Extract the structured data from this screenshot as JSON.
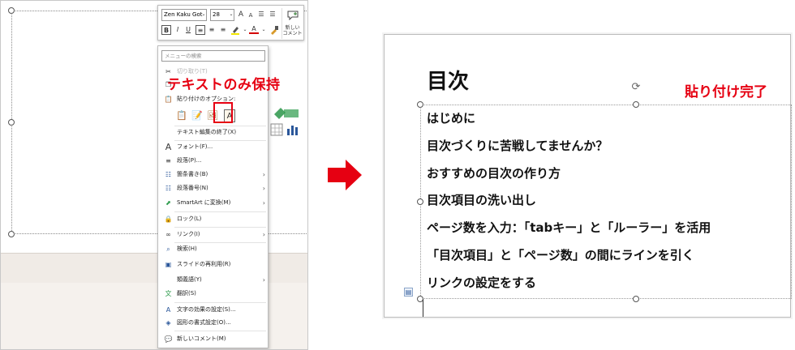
{
  "left_panel": {
    "mini_toolbar": {
      "font_name": "Zen Kaku Got",
      "font_size": "28",
      "grow_font": "A",
      "shrink_font": "A",
      "bold": "B",
      "italic": "I",
      "underline": "U",
      "font_color_letter": "A",
      "new_comment_label_1": "新しい",
      "new_comment_label_2": "コメント"
    },
    "menu": {
      "search_placeholder": "メニューの検索",
      "cut": "切り取り(T)",
      "paste_options_label": "貼り付けのオプション:",
      "exit_text_edit": "テキスト編集の終了(X)",
      "font": "フォント(F)...",
      "paragraph": "段落(P)...",
      "bullets": "箇条書き(B)",
      "numbering": "段落番号(N)",
      "smartart": "SmartArt に変換(M)",
      "lock": "ロック(L)",
      "link": "リンク(I)",
      "search": "検索(H)",
      "reuse_slides": "スライドの再利用(R)",
      "synonyms": "類義語(Y)",
      "translate": "翻訳(S)",
      "text_effects": "文字の効果の設定(S)...",
      "shape_format": "図形の書式設定(O)...",
      "new_comment": "新しいコメント(M)"
    },
    "callout": "テキストのみ保持"
  },
  "right_panel": {
    "title": "目次",
    "callout": "貼り付け完了",
    "lines": [
      "はじめに",
      "目次づくりに苦戦してませんか？",
      "おすすめの目次の作り方",
      "目次項目の洗い出し",
      "ページ数を入力：「tabキー」と「ルーラー」を活用",
      "「目次項目」と「ページ数」の間にラインを引く",
      "リンクの設定をする"
    ]
  },
  "colors": {
    "accent_red": "#e60012",
    "highlight_yellow": "#f2e600",
    "font_color_red": "#d40000"
  },
  "icons": {
    "arrow": "right-arrow-icon",
    "rotate": "rotate-handle-icon",
    "keep_text_only": "paste-keep-text-only-icon"
  }
}
